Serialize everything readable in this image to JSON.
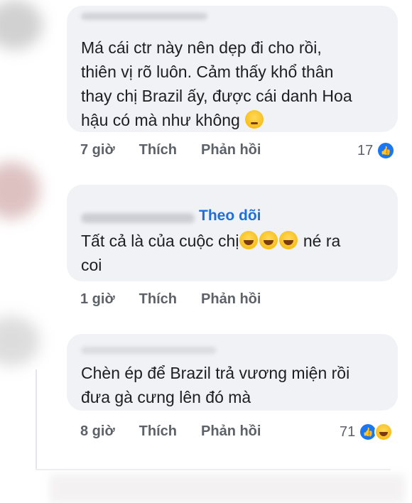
{
  "comments": [
    {
      "text": "Má cái ctr này nên dẹp đi cho rồi,\nthiên vị rõ luôn. Cảm thấy khổ thân\nthay chị Brazil ấy, được cái danh Hoa\nhậu có mà như không",
      "emoji": "pensive-face",
      "time": "7 giờ",
      "like_label": "Thích",
      "reply_label": "Phản hồi",
      "reaction_count": "17"
    },
    {
      "follow_label": "Theo dõi",
      "text_before": "Tất cả là của cuộc chị",
      "emojis": [
        "tears-of-joy",
        "tears-of-joy",
        "tears-of-joy"
      ],
      "text_after": " né ra\ncoi",
      "time": "1 giờ",
      "like_label": "Thích",
      "reply_label": "Phản hồi"
    },
    {
      "text": "Chèn ép để Brazil trả vương miện rồi\nđưa gà cưng lên đó mà",
      "time": "8 giờ",
      "like_label": "Thích",
      "reply_label": "Phản hồi",
      "reaction_count": "71",
      "reactions": [
        "like",
        "haha"
      ]
    }
  ],
  "colors": {
    "bubble": "#f0f2f5",
    "link_blue": "#1d6fe0",
    "like_blue": "#1877f2",
    "meta_gray": "#5d6168"
  }
}
